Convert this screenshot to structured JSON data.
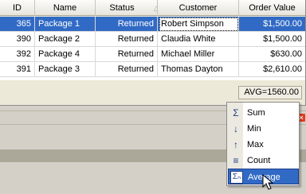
{
  "grid": {
    "columns": [
      "ID",
      "Name",
      "Status",
      "Customer",
      "Order Value"
    ],
    "sort_glyph": "△",
    "filter_glyph": "▾",
    "rows": [
      {
        "id": "365",
        "name": "Package 1",
        "status": "Returned",
        "customer": "Robert Simpson",
        "value": "$1,500.00"
      },
      {
        "id": "390",
        "name": "Package 2",
        "status": "Returned",
        "customer": "Claudia White",
        "value": "$1,500.00"
      },
      {
        "id": "392",
        "name": "Package 4",
        "status": "Returned",
        "customer": "Michael Miller",
        "value": "$630.00"
      },
      {
        "id": "391",
        "name": "Package 3",
        "status": "Returned",
        "customer": "Thomas Dayton",
        "value": "$2,610.00"
      }
    ],
    "summary": "AVG=1560.00"
  },
  "panel": {
    "close_glyph": "×"
  },
  "menu": {
    "items": [
      {
        "label": "Sum",
        "icon": "Σ",
        "icon_name": "sum-icon"
      },
      {
        "label": "Min",
        "icon": "↓",
        "icon_name": "min-icon"
      },
      {
        "label": "Max",
        "icon": "↑",
        "icon_name": "max-icon"
      },
      {
        "label": "Count",
        "icon": "≡",
        "icon_name": "count-icon"
      },
      {
        "label": "Average",
        "icon": "Σₙ",
        "icon_name": "average-icon"
      }
    ]
  },
  "colors": {
    "selection": "#316ac5",
    "panel": "#ece9d8",
    "close": "#e23b1e"
  }
}
